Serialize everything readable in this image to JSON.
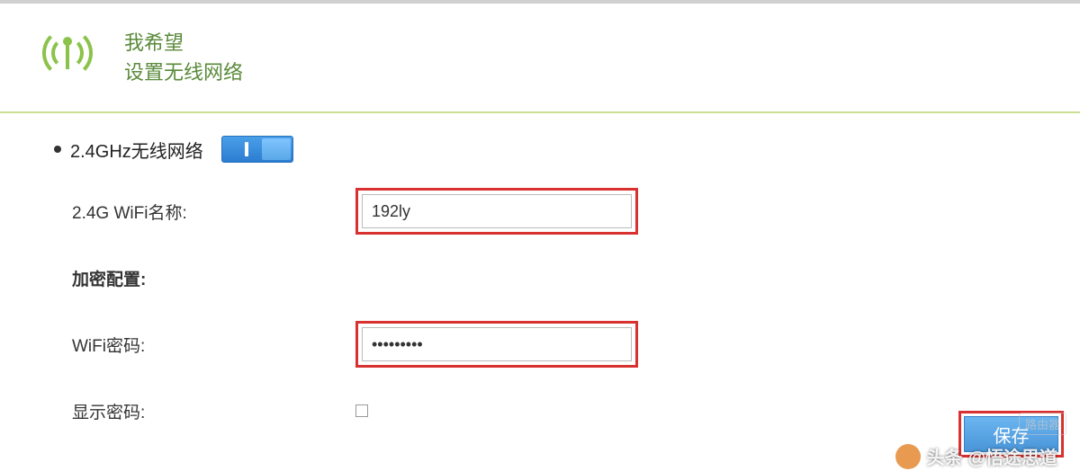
{
  "header": {
    "line1": "我希望",
    "line2": "设置无线网络"
  },
  "section": {
    "title": "2.4GHz无线网络"
  },
  "form": {
    "wifi_name_label": "2.4G WiFi名称:",
    "wifi_name_value": "192ly",
    "encryption_label": "加密配置:",
    "wifi_password_label": "WiFi密码:",
    "wifi_password_value": "•••••••••",
    "show_password_label": "显示密码:"
  },
  "actions": {
    "save_label": "保存"
  },
  "watermark": {
    "badge": "路由器",
    "prefix": "头条",
    "author": "@悟途思道"
  }
}
